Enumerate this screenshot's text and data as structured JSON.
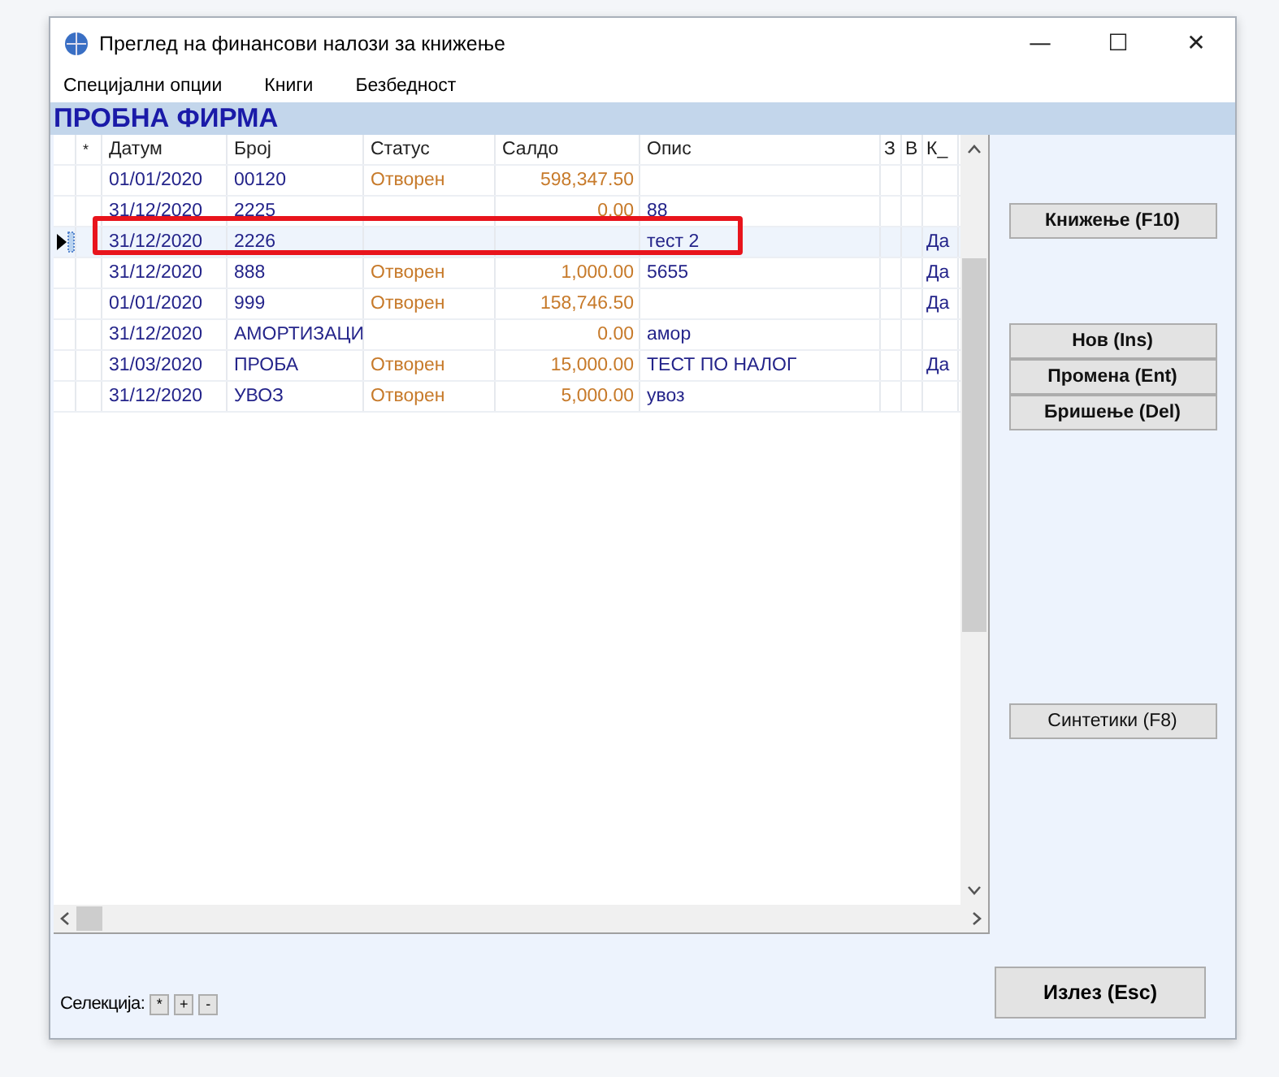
{
  "window": {
    "title": "Преглед на финансови налози за книжење",
    "controls": [
      "—",
      "☐",
      "✕"
    ]
  },
  "menu": [
    {
      "label": "Специјални опции"
    },
    {
      "label": "Книги"
    },
    {
      "label": "Безбедност"
    }
  ],
  "company": "ПРОБНА ФИРМА",
  "table": {
    "columns": [
      "*",
      "Датум",
      "Број",
      "Статус",
      "Салдо",
      "Опис",
      "З",
      "В",
      "К_"
    ],
    "rows": [
      {
        "selected": false,
        "cells": [
          "",
          "01/01/2020",
          " 00120",
          "Отворен",
          "598,347.50",
          "",
          "",
          "",
          ""
        ]
      },
      {
        "selected": false,
        "cells": [
          "",
          "31/12/2020",
          "2225",
          "",
          "0.00",
          "88",
          "",
          "",
          ""
        ]
      },
      {
        "selected": true,
        "cells": [
          "",
          "31/12/2020",
          "2226",
          "",
          "",
          "тест 2",
          "",
          "",
          "Да"
        ]
      },
      {
        "selected": false,
        "cells": [
          "",
          "31/12/2020",
          "888",
          "Отворен",
          "1,000.00",
          "5655",
          "",
          "",
          "Да"
        ]
      },
      {
        "selected": false,
        "cells": [
          "",
          "01/01/2020",
          "999",
          "Отворен",
          "158,746.50",
          "",
          "",
          "",
          "Да"
        ]
      },
      {
        "selected": false,
        "cells": [
          "",
          "31/12/2020",
          "АМОРТИЗАЦИ",
          "",
          "0.00",
          "амор",
          "",
          "",
          ""
        ]
      },
      {
        "selected": false,
        "cells": [
          "",
          "31/03/2020",
          "ПРОБА",
          "Отворен",
          "15,000.00",
          "ТЕСТ ПО НАЛОГ",
          "",
          "",
          "Да"
        ]
      },
      {
        "selected": false,
        "cells": [
          "",
          "31/12/2020",
          "УВОЗ",
          "Отворен",
          "5,000.00",
          "увоз",
          "",
          "",
          ""
        ]
      }
    ]
  },
  "side_buttons": [
    {
      "label": "Книжење (F10)",
      "kind": "bold"
    },
    {
      "label": "Нов (Ins)",
      "kind": "bold"
    },
    {
      "label": "Промена (Ent)",
      "kind": "bold"
    },
    {
      "label": "Бришење (Del)",
      "kind": "bold"
    },
    {
      "label": "Синтетики (F8)",
      "kind": "plain"
    }
  ],
  "selection": {
    "label": "Селекција:",
    "buttons": [
      "*",
      "+",
      "-"
    ]
  },
  "exit_button": "Излез (Esc)"
}
